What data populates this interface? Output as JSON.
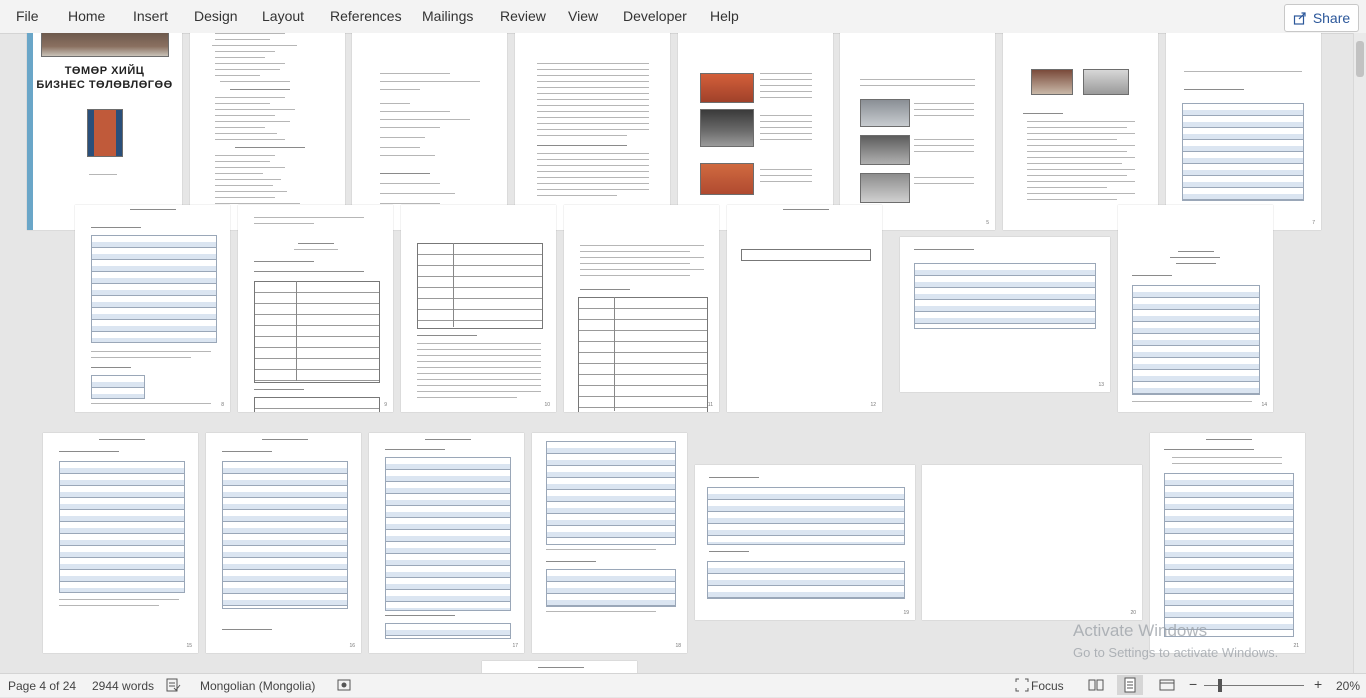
{
  "ribbon": {
    "tabs": [
      "File",
      "Home",
      "Insert",
      "Design",
      "Layout",
      "References",
      "Mailings",
      "Review",
      "View",
      "Developer",
      "Help"
    ],
    "share_label": "Share"
  },
  "document": {
    "cover_title_line1": "ТӨМӨР ХИЙЦ",
    "cover_title_line2": "БИЗНЕС ТӨЛӨВЛӨГӨӨ"
  },
  "status": {
    "page": "Page 4 of 24",
    "words": "2944 words",
    "language": "Mongolian (Mongolia)",
    "focus_label": "Focus",
    "zoom": "20%"
  },
  "watermark": {
    "line1": "Activate Windows",
    "line2": "Go to Settings to activate Windows."
  },
  "icons": {
    "share": "share-icon",
    "proofing": "proofing-icon",
    "macro": "macro-record-icon",
    "focus": "focus-icon",
    "read_mode": "read-mode-icon",
    "print_layout": "print-layout-icon",
    "web_layout": "web-layout-icon"
  }
}
